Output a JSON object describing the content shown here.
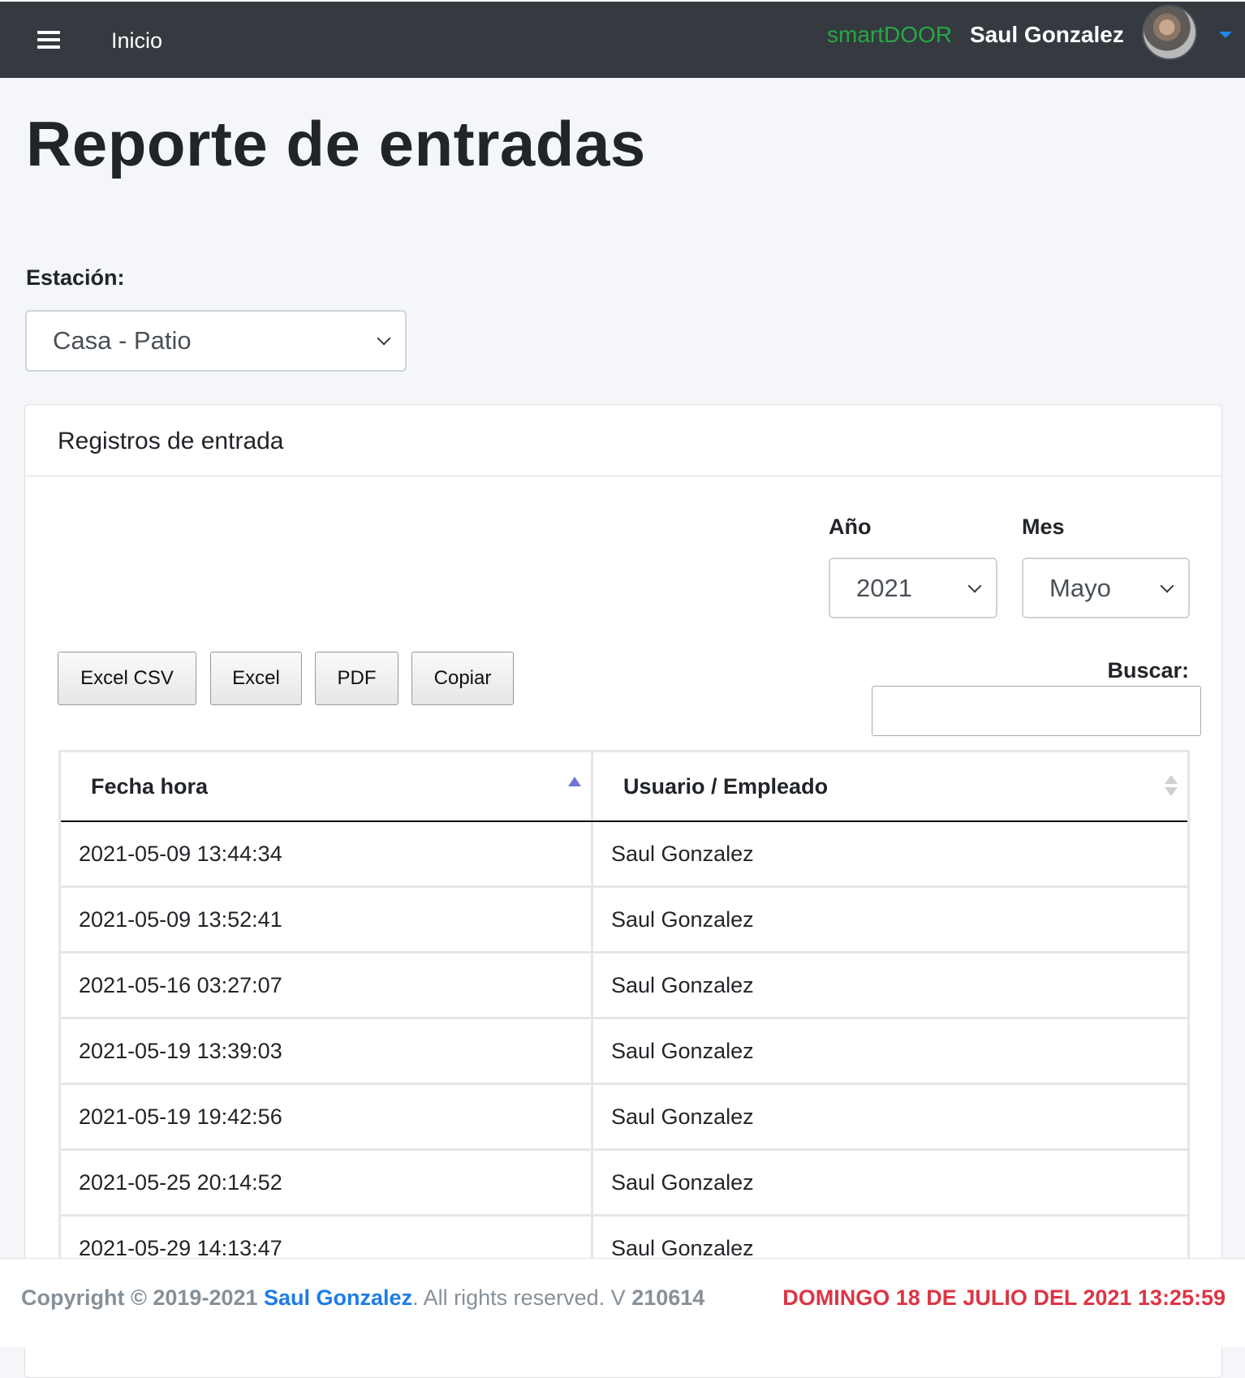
{
  "navbar": {
    "home_label": "Inicio",
    "brand": "smartDOOR",
    "user_name": "Saul Gonzalez",
    "menu_icon": "hamburger-icon",
    "caret_icon": "caret-down-icon",
    "brand_color": "#28a745",
    "background_color": "#343a40"
  },
  "page": {
    "title": "Reporte de entradas",
    "station_label": "Estación:",
    "station_selected": "Casa - Patio"
  },
  "card": {
    "title": "Registros de entrada",
    "year_label": "Año",
    "year_selected": "2021",
    "month_label": "Mes",
    "month_selected": "Mayo",
    "buttons": [
      "Excel CSV",
      "Excel",
      "PDF",
      "Copiar"
    ],
    "search_label": "Buscar:",
    "search_value": ""
  },
  "table": {
    "headers": [
      "Fecha hora",
      "Usuario / Empleado"
    ],
    "rows": [
      [
        "2021-05-09 13:44:34",
        "Saul Gonzalez"
      ],
      [
        "2021-05-09 13:52:41",
        "Saul Gonzalez"
      ],
      [
        "2021-05-16 03:27:07",
        "Saul Gonzalez"
      ],
      [
        "2021-05-19 13:39:03",
        "Saul Gonzalez"
      ],
      [
        "2021-05-19 19:42:56",
        "Saul Gonzalez"
      ],
      [
        "2021-05-25 20:14:52",
        "Saul Gonzalez"
      ],
      [
        "2021-05-29 14:13:47",
        "Saul Gonzalez"
      ]
    ],
    "sort_active_color": "#6f74d6"
  },
  "footer": {
    "copyright_prefix": "Copyright © 2019-2021",
    "author": "Saul Gonzalez",
    "rights_text": ". All rights reserved. V",
    "version": "210614",
    "datetime": "DOMINGO 18 DE JULIO DEL 2021 13:25:59",
    "author_color": "#1e7be6",
    "datetime_color": "#dc3545"
  }
}
